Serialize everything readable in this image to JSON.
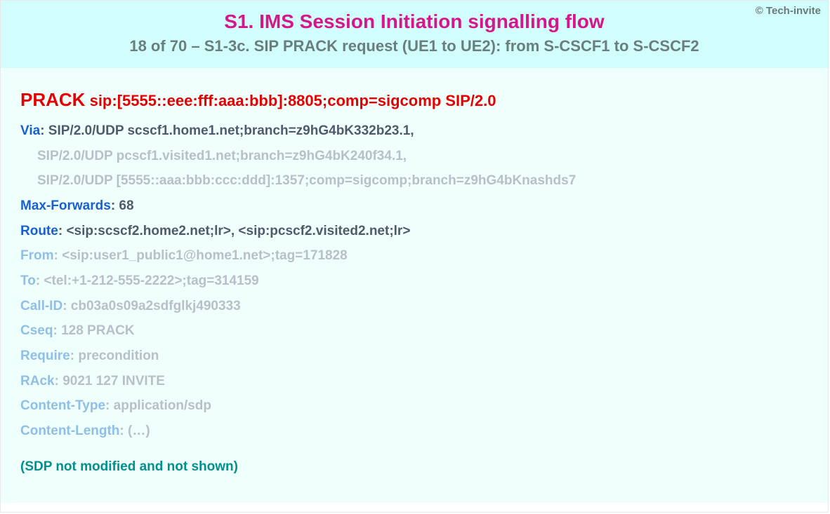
{
  "copyright": "© Tech-invite",
  "header": {
    "title": "S1. IMS Session Initiation signalling flow",
    "subtitle": "18 of 70 – S1-3c. SIP PRACK request (UE1 to UE2): from S-CSCF1 to S-CSCF2"
  },
  "sip": {
    "method": "PRACK",
    "request_uri": "sip:[5555::eee:fff:aaa:bbb]:8805;comp=sigcomp SIP/2.0",
    "via": {
      "name": "Via",
      "first": "SIP/2.0/UDP scscf1.home1.net;branch=z9hG4bK332b23.1,",
      "cont1": "SIP/2.0/UDP pcscf1.visited1.net;branch=z9hG4bK240f34.1,",
      "cont2": "SIP/2.0/UDP [5555::aaa:bbb:ccc:ddd]:1357;comp=sigcomp;branch=z9hG4bKnashds7"
    },
    "max_forwards": {
      "name": "Max-Forwards",
      "value": "68"
    },
    "route": {
      "name": "Route",
      "value": "<sip:scscf2.home2.net;lr>, <sip:pcscf2.visited2.net;lr>"
    },
    "from": {
      "name": "From",
      "value": "<sip:user1_public1@home1.net>;tag=171828"
    },
    "to": {
      "name": "To",
      "value": "<tel:+1-212-555-2222>;tag=314159"
    },
    "call_id": {
      "name": "Call-ID",
      "value": "cb03a0s09a2sdfglkj490333"
    },
    "cseq": {
      "name": "Cseq",
      "value": "128 PRACK"
    },
    "require": {
      "name": "Require",
      "value": "precondition"
    },
    "rack": {
      "name": "RAck",
      "value": "9021 127 INVITE"
    },
    "content_type": {
      "name": "Content-Type",
      "value": "application/sdp"
    },
    "content_length": {
      "name": "Content-Length",
      "value": "(…)"
    }
  },
  "note": "(SDP not modified and not shown)"
}
